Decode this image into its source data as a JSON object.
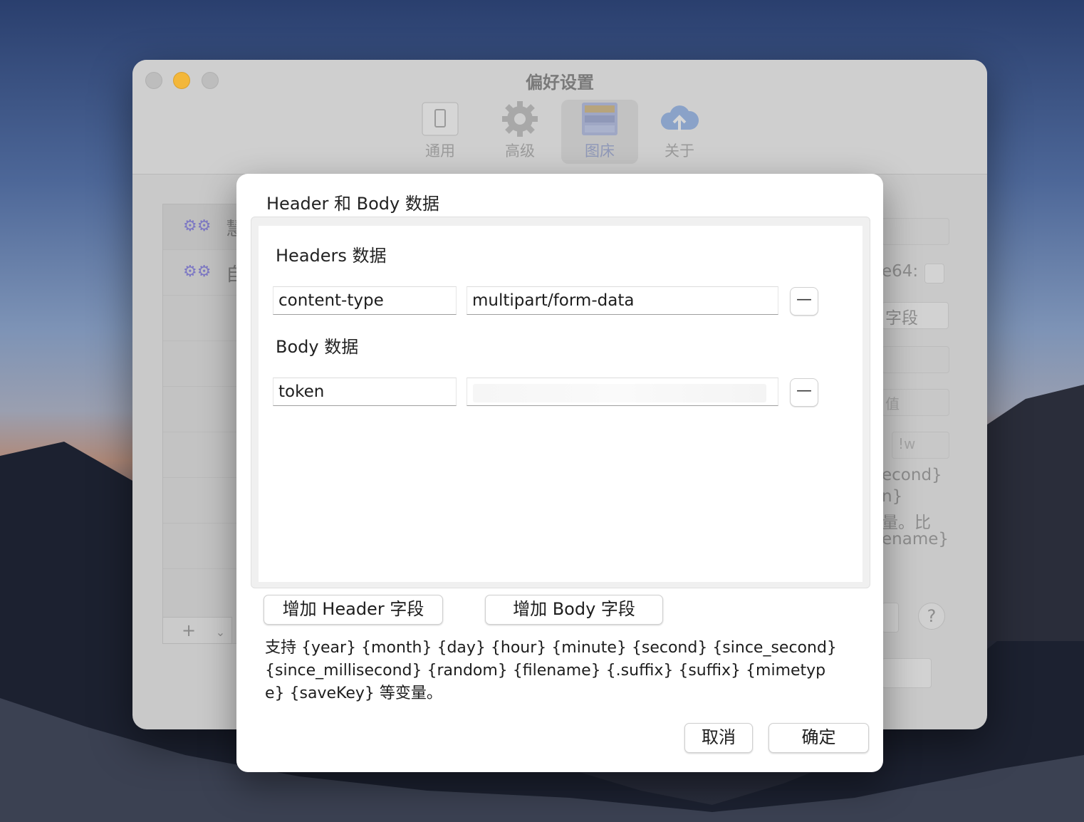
{
  "window": {
    "title": "偏好设置",
    "toolbar": [
      {
        "label": "通用",
        "icon": "general-icon"
      },
      {
        "label": "高级",
        "icon": "gear-icon"
      },
      {
        "label": "图床",
        "icon": "image-host-icon"
      },
      {
        "label": "关于",
        "icon": "cloud-upload-icon"
      }
    ],
    "sidebar": [
      {
        "label": "慧"
      },
      {
        "label": "自"
      }
    ],
    "sidebar_add": "+",
    "right_fragments": {
      "base64": "e64:",
      "field_btn": "字段",
      "value": "值",
      "w": "!w",
      "line1": "econd}",
      "line2": "n}",
      "line3": "量。比",
      "line4": "ename}",
      "help": "?"
    }
  },
  "dialog": {
    "title": "Header 和 Body 数据",
    "headers_label": "Headers 数据",
    "body_label": "Body 数据",
    "header_rows": [
      {
        "key": "content-type",
        "value": "multipart/form-data"
      }
    ],
    "body_rows": [
      {
        "key": "token",
        "value": ""
      }
    ],
    "remove_label": "—",
    "add_header_button": "增加 Header 字段",
    "add_body_button": "增加 Body 字段",
    "help_text": "支持 {year} {month} {day} {hour} {minute} {second} {since_second} {since_millisecond} {random} {filename} {.suffix} {suffix} {mimetype} {saveKey} 等变量。",
    "cancel_button": "取消",
    "ok_button": "确定"
  }
}
